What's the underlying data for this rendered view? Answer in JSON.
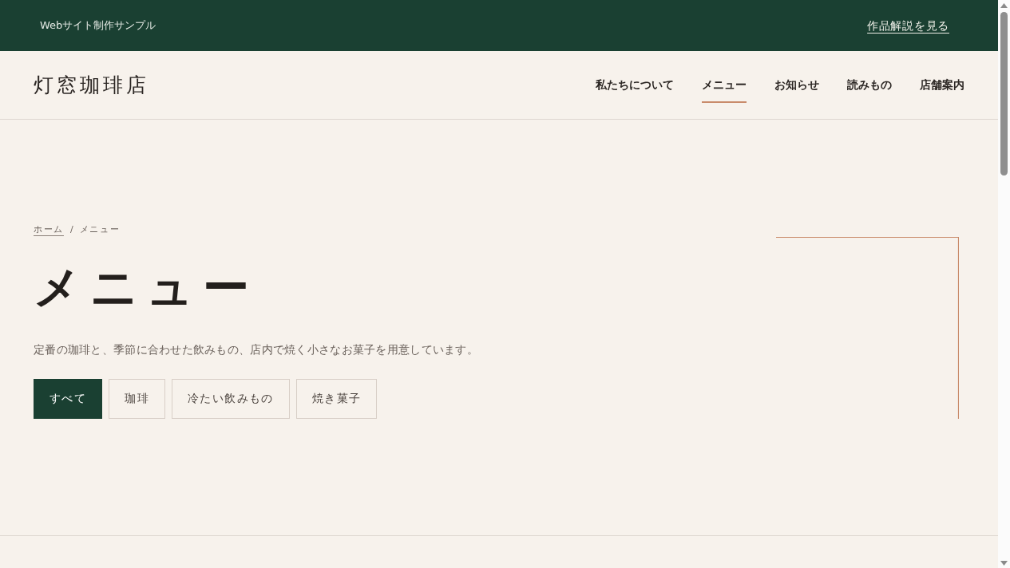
{
  "top_bar": {
    "label": "Webサイト制作サンプル",
    "link": "作品解説を見る"
  },
  "header": {
    "logo": "灯窓珈琲店",
    "nav": [
      {
        "label": "私たちについて",
        "selected": false
      },
      {
        "label": "メニュー",
        "selected": true
      },
      {
        "label": "お知らせ",
        "selected": false
      },
      {
        "label": "読みもの",
        "selected": false
      },
      {
        "label": "店舗案内",
        "selected": false
      }
    ]
  },
  "hero": {
    "breadcrumb": [
      {
        "label": "ホーム",
        "kind": "link"
      },
      {
        "label": "/",
        "kind": "separator"
      },
      {
        "label": "メニュー",
        "kind": "current"
      }
    ],
    "title": "メニュー",
    "description": "定番の珈琲と、季節に合わせた飲みもの、店内で焼く小さなお菓子を用意しています。",
    "filters": [
      {
        "label": "すべて",
        "selected": true
      },
      {
        "label": "珈琲",
        "selected": false
      },
      {
        "label": "冷たい飲みもの",
        "selected": false
      },
      {
        "label": "焼き菓子",
        "selected": false
      }
    ]
  }
}
